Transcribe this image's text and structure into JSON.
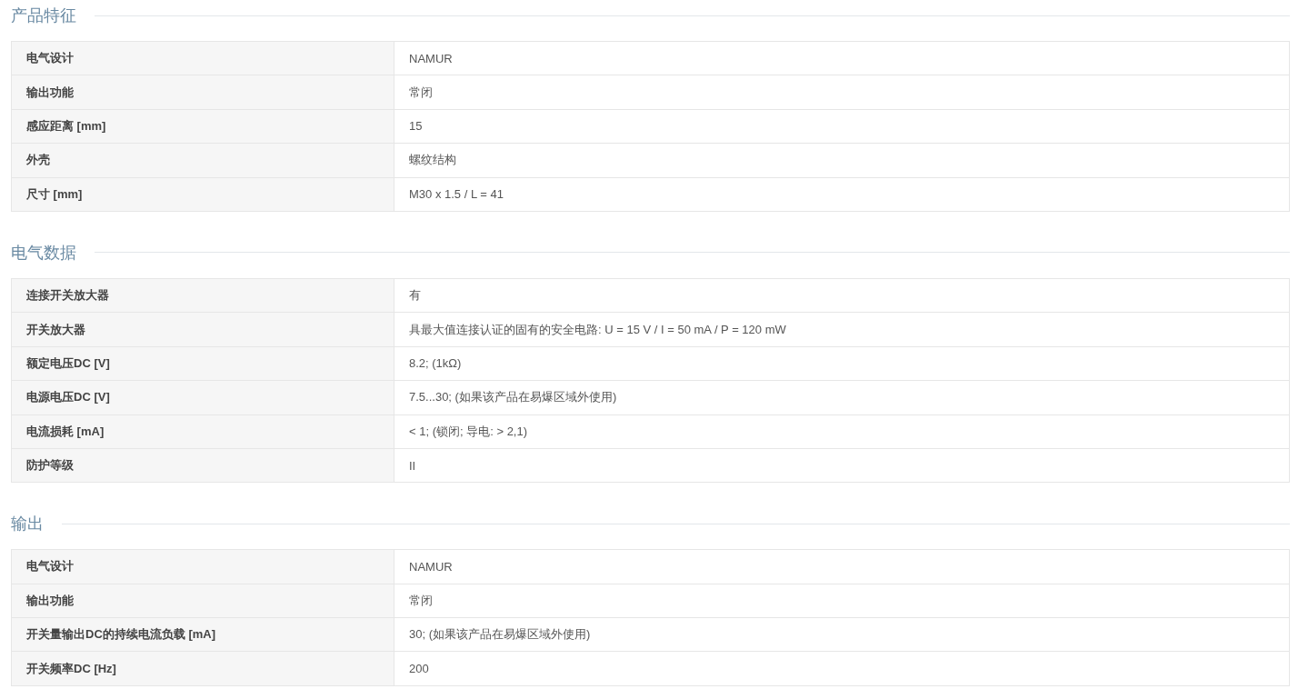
{
  "sections": [
    {
      "title": "产品特征",
      "rows": [
        {
          "label": "电气设计",
          "value": "NAMUR"
        },
        {
          "label": "输出功能",
          "value": "常闭"
        },
        {
          "label": "感应距离 [mm]",
          "value": "15"
        },
        {
          "label": "外壳",
          "value": "螺纹结构"
        },
        {
          "label": "尺寸 [mm]",
          "value": "M30 x 1.5 / L = 41"
        }
      ]
    },
    {
      "title": "电气数据",
      "rows": [
        {
          "label": "连接开关放大器",
          "value": "有"
        },
        {
          "label": "开关放大器",
          "value": "具最大值连接认证的固有的安全电路: U = 15 V / I = 50 mA / P = 120 mW"
        },
        {
          "label": "额定电压DC [V]",
          "value": "8.2; (1kΩ)"
        },
        {
          "label": "电源电压DC [V]",
          "value": "7.5...30; (如果该产品在易爆区域外使用)"
        },
        {
          "label": "电流损耗 [mA]",
          "value": "< 1; (锁闭; 导电: > 2,1)"
        },
        {
          "label": "防护等级",
          "value": "II"
        }
      ]
    },
    {
      "title": "输出",
      "rows": [
        {
          "label": "电气设计",
          "value": "NAMUR"
        },
        {
          "label": "输出功能",
          "value": "常闭"
        },
        {
          "label": "开关量输出DC的持续电流负载 [mA]",
          "value": "30; (如果该产品在易爆区域外使用)"
        },
        {
          "label": "开关频率DC [Hz]",
          "value": "200"
        }
      ]
    }
  ]
}
